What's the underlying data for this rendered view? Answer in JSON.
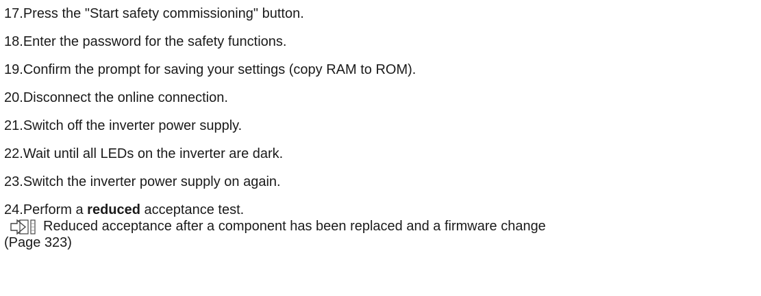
{
  "steps": [
    {
      "num": "17.",
      "text": "Press the \"Start safety commissioning\" button."
    },
    {
      "num": "18.",
      "text": "Enter the password for the safety functions."
    },
    {
      "num": "19.",
      "text": "Confirm the prompt for saving your settings (copy RAM to ROM)."
    },
    {
      "num": "20.",
      "text": "Disconnect the online connection."
    },
    {
      "num": "21.",
      "text": "Switch off the inverter power supply."
    },
    {
      "num": "22.",
      "text": "Wait until all LEDs on the inverter are dark."
    },
    {
      "num": "23.",
      "text": "Switch the inverter power supply on again."
    }
  ],
  "last_step": {
    "num": "24.",
    "text_before": "Perform a ",
    "text_bold": "reduced",
    "text_after": " acceptance test.",
    "xref": {
      "icon": "cross-reference-arrow-icon",
      "text": "Reduced acceptance after a component has been replaced and a firmware change",
      "page": "(Page 323)"
    }
  }
}
